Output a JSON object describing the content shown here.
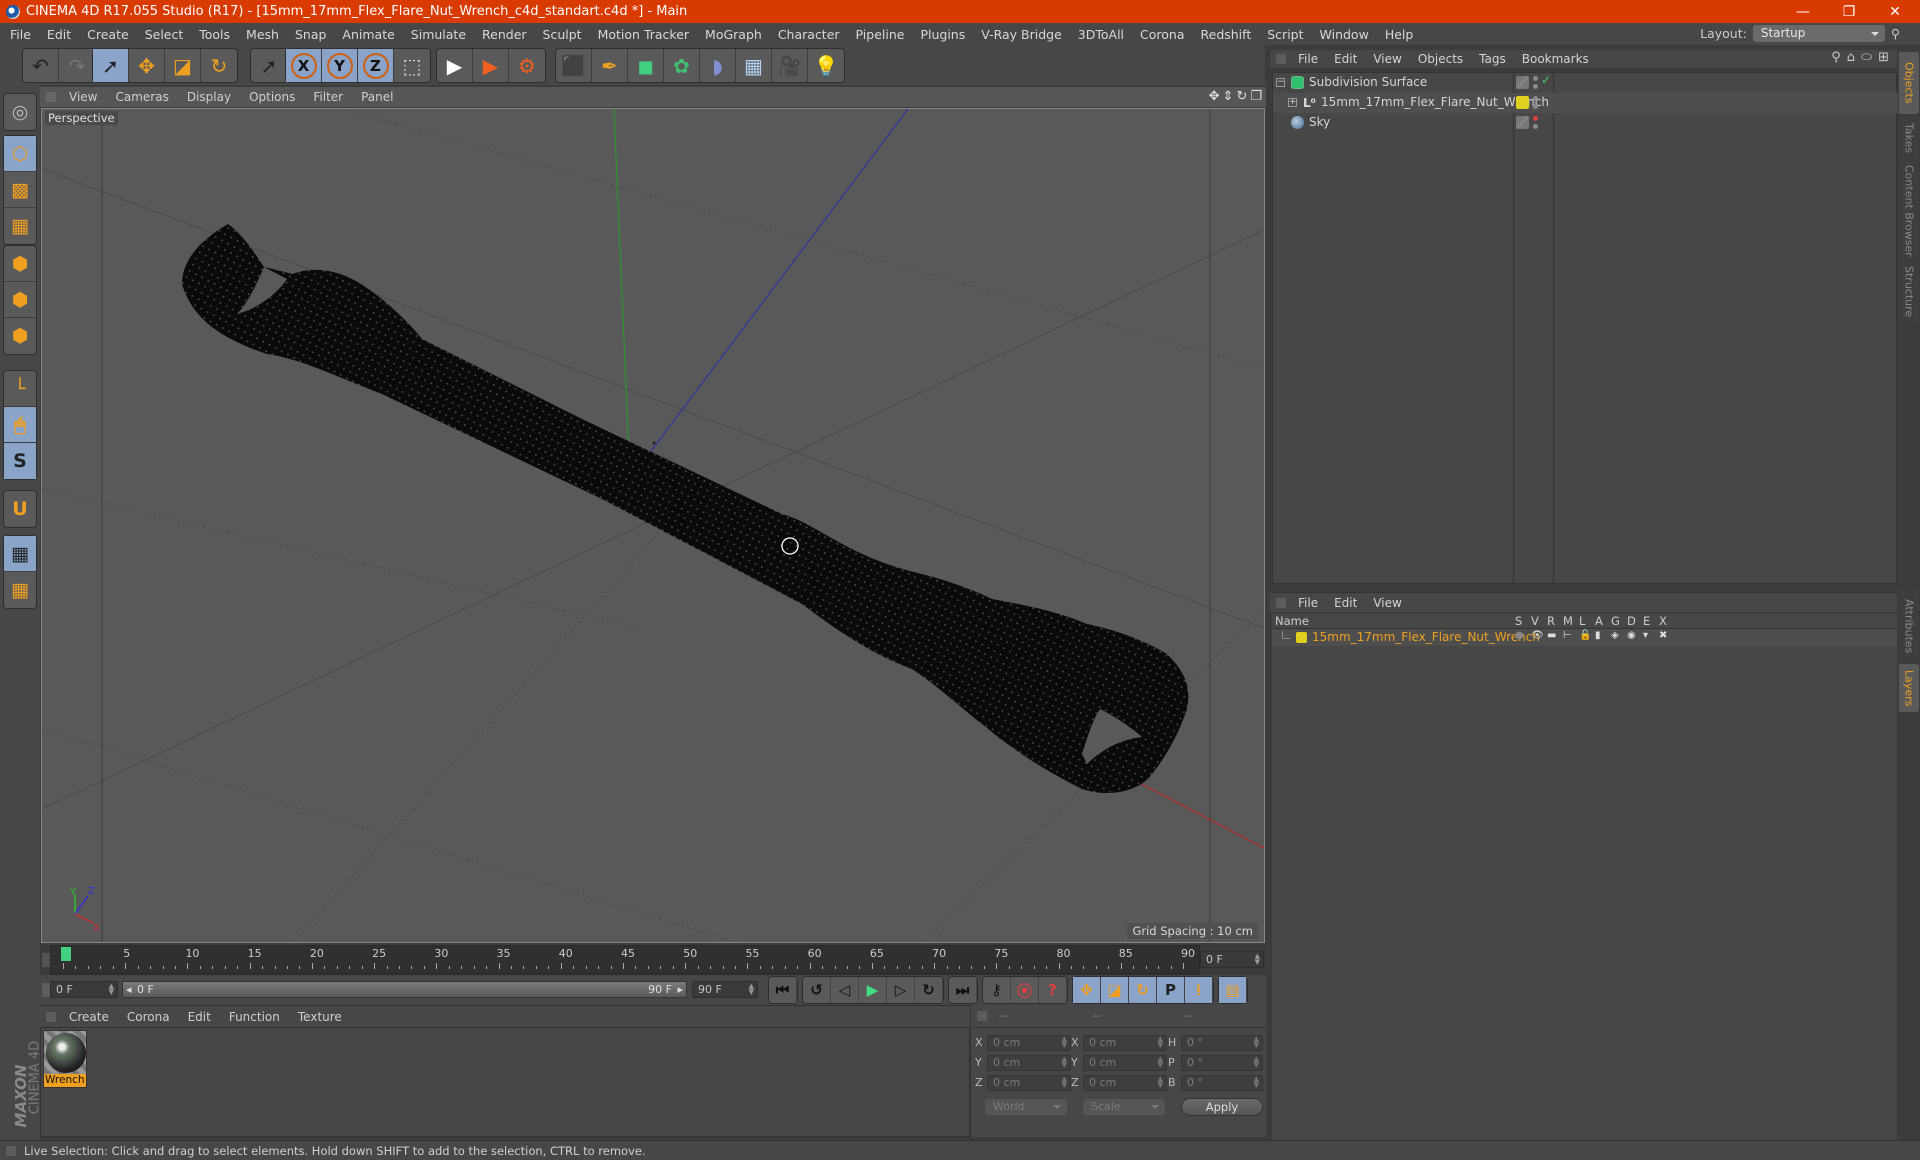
{
  "app": {
    "title": "CINEMA 4D R17.055 Studio (R17) - [15mm_17mm_Flex_Flare_Nut_Wrench_c4d_standart.c4d *] - Main",
    "window_controls": {
      "minimize": "—",
      "restore": "❐",
      "close": "✕"
    }
  },
  "menubar": {
    "items": [
      "File",
      "Edit",
      "Create",
      "Select",
      "Tools",
      "Mesh",
      "Snap",
      "Animate",
      "Simulate",
      "Render",
      "Sculpt",
      "Motion Tracker",
      "MoGraph",
      "Character",
      "Pipeline",
      "Plugins",
      "V-Ray Bridge",
      "3DToAll",
      "Corona",
      "Redshift",
      "Script",
      "Window",
      "Help"
    ],
    "layout_label": "Layout:",
    "layout_value": "Startup"
  },
  "toolbar": {
    "groups": [
      {
        "items": [
          {
            "icon": "undo-icon",
            "active": false
          },
          {
            "icon": "redo-icon",
            "active": false
          }
        ]
      },
      {
        "items": [
          {
            "icon": "live-selection-icon",
            "active": true
          },
          {
            "icon": "move-icon",
            "active": false
          },
          {
            "icon": "scale-icon",
            "active": false
          },
          {
            "icon": "rotate-icon",
            "active": false
          }
        ]
      },
      {
        "items": [
          {
            "icon": "recent-tool-icon",
            "active": false
          }
        ]
      },
      {
        "items": [
          {
            "icon": "x-axis-icon",
            "label": "X",
            "active": true
          },
          {
            "icon": "y-axis-icon",
            "label": "Y",
            "active": true
          },
          {
            "icon": "z-axis-icon",
            "label": "Z",
            "active": true
          },
          {
            "icon": "coordinate-system-icon",
            "active": false
          }
        ]
      },
      {
        "items": [
          {
            "icon": "render-view-icon",
            "active": false
          },
          {
            "icon": "render-picture-viewer-icon",
            "active": false
          },
          {
            "icon": "render-settings-icon",
            "active": false
          }
        ]
      },
      {
        "items": [
          {
            "icon": "cube-primitive-icon",
            "active": false
          },
          {
            "icon": "pen-spline-icon",
            "active": false
          },
          {
            "icon": "subdivision-surface-icon",
            "active": false
          },
          {
            "icon": "cloner-icon",
            "active": false
          },
          {
            "icon": "bend-deformer-icon",
            "active": false
          },
          {
            "icon": "floor-icon",
            "active": false
          },
          {
            "icon": "camera-icon",
            "active": false
          },
          {
            "icon": "light-icon",
            "active": false
          }
        ]
      }
    ]
  },
  "left_tools": [
    {
      "icon": "make-editable-icon",
      "active": false
    },
    {
      "icon": "model-mode-icon",
      "active": true
    },
    {
      "icon": "texture-mode-icon",
      "active": false
    },
    {
      "icon": "workplane-mode-icon",
      "active": false
    },
    {
      "icon": "points-mode-icon",
      "active": false
    },
    {
      "icon": "edges-mode-icon",
      "active": false
    },
    {
      "icon": "polygons-mode-icon",
      "active": false
    },
    {
      "icon": "axis-mode-icon",
      "active": false
    },
    {
      "icon": "tweak-mode-icon",
      "active": true
    },
    {
      "icon": "solo-mode-icon",
      "active": true
    },
    {
      "icon": "snapping-icon",
      "active": false
    },
    {
      "icon": "workplane-lock-icon",
      "active": true
    },
    {
      "icon": "workplane-align-icon",
      "active": false
    }
  ],
  "viewport": {
    "menu": [
      "View",
      "Cameras",
      "Display",
      "Options",
      "Filter",
      "Panel"
    ],
    "label": "Perspective",
    "grid_spacing": "Grid Spacing : 10 cm",
    "axis_labels": {
      "x": "X",
      "y": "Y",
      "z": "Z"
    },
    "nav_icons": [
      "pan-icon",
      "dolly-icon",
      "orbit-icon",
      "maximize-view-icon"
    ]
  },
  "timeline": {
    "ticks": [
      "0",
      "5",
      "10",
      "15",
      "20",
      "25",
      "30",
      "35",
      "40",
      "45",
      "50",
      "55",
      "60",
      "65",
      "70",
      "75",
      "80",
      "85",
      "90"
    ],
    "current_frame": "0 F",
    "start_field": "0 F",
    "range_start": "0 F",
    "range_end": "90 F",
    "end_field": "90 F",
    "current_field": "0 F"
  },
  "playback": {
    "buttons": [
      "go-to-start-icon",
      "previous-keyframe-icon",
      "previous-frame-icon",
      "play-icon",
      "next-frame-icon",
      "next-keyframe-icon",
      "go-to-end-icon"
    ],
    "record_buttons": [
      "motion-recording-icon",
      "record-active-objects-icon",
      "autokeying-icon"
    ],
    "key_buttons": [
      "key-position-icon",
      "key-scale-icon",
      "key-rotation-icon",
      "key-parameter-icon",
      "key-point-level-icon",
      "timeline-window-icon"
    ]
  },
  "material_manager": {
    "menu": [
      "Create",
      "Corona",
      "Edit",
      "Function",
      "Texture"
    ],
    "materials": [
      {
        "name": "Wrench",
        "selected": true
      }
    ]
  },
  "coordinates": {
    "headers": [
      "--",
      "--",
      "--"
    ],
    "rows": [
      {
        "l1": "X",
        "v1": "0 cm",
        "l2": "X",
        "v2": "0 cm",
        "l3": "H",
        "v3": "0 °"
      },
      {
        "l1": "Y",
        "v1": "0 cm",
        "l2": "Y",
        "v2": "0 cm",
        "l3": "P",
        "v3": "0 °"
      },
      {
        "l1": "Z",
        "v1": "0 cm",
        "l2": "Z",
        "v2": "0 cm",
        "l3": "B",
        "v3": "0 °"
      }
    ],
    "mode_select": "World",
    "transform_select": "Scale",
    "apply_label": "Apply"
  },
  "object_manager": {
    "menu": [
      "File",
      "Edit",
      "View",
      "Objects",
      "Tags",
      "Bookmarks"
    ],
    "objects": [
      {
        "name": "Subdivision Surface",
        "indent": 0,
        "icon": "subdivision-surface-icon",
        "expander": "−",
        "tag": "gray",
        "dot_top": "#8a8a8a",
        "check": "✓"
      },
      {
        "name": "15mm_17mm_Flex_Flare_Nut_Wrench",
        "indent": 1,
        "icon": "null-object-icon",
        "expander": "+",
        "tag": "yellow",
        "dot_top": "#8a8a8a",
        "check": ""
      },
      {
        "name": "Sky",
        "indent": 0,
        "icon": "sky-icon",
        "expander": "",
        "tag": "gray",
        "dot_top": "#e04040",
        "check": ""
      }
    ]
  },
  "layer_manager": {
    "menu": [
      "File",
      "Edit",
      "View"
    ],
    "columns": [
      "Name",
      "S",
      "V",
      "R",
      "M",
      "L",
      "A",
      "G",
      "D",
      "E",
      "X"
    ],
    "layers": [
      {
        "name": "15mm_17mm_Flex_Flare_Nut_Wrench",
        "color": "#e0d020"
      }
    ]
  },
  "side_tabs_top": [
    {
      "label": "Objects",
      "active": true
    },
    {
      "label": "Takes",
      "active": false
    },
    {
      "label": "Content Browser",
      "active": false
    },
    {
      "label": "Structure",
      "active": false
    }
  ],
  "side_tabs_bottom": [
    {
      "label": "Attributes",
      "active": false
    },
    {
      "label": "Layers",
      "active": true
    }
  ],
  "branding": {
    "line1": "MAXON",
    "line2": "CINEMA 4D"
  },
  "status": {
    "text": "Live Selection: Click and drag to select elements. Hold down SHIFT to add to the selection, CTRL to remove."
  },
  "colors": {
    "titlebar": "#d93a00",
    "accent_orange": "#f0a020",
    "active_blue": "#8aa3c8",
    "axis_x": "#d03030",
    "axis_y": "#30c030",
    "axis_z": "#3030c0"
  }
}
